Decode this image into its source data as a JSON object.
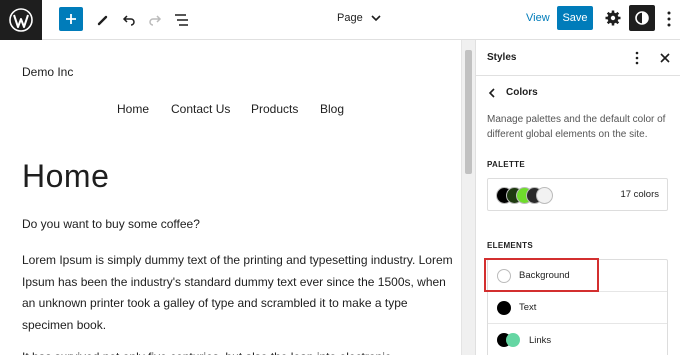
{
  "toolbar": {
    "document_title": "Page",
    "view_label": "View",
    "save_label": "Save"
  },
  "canvas": {
    "site_title": "Demo Inc",
    "nav_items": [
      "Home",
      "Contact Us",
      "Products",
      "Blog"
    ],
    "page_heading": "Home",
    "paragraphs": [
      "Do you want to buy some coffee?",
      "Lorem Ipsum is simply dummy text of the printing and typesetting industry. Lorem Ipsum has been the industry's standard dummy text ever since the 1500s, when an unknown printer took a galley of type and scrambled it to make a type specimen book.",
      "It has survived not only five centuries, but also the leap into electronic"
    ]
  },
  "sidebar": {
    "title": "Styles",
    "subpanel_title": "Colors",
    "description": "Manage palettes and the default color of different global elements on the site.",
    "palette_label": "PALETTE",
    "palette_count": "17 colors",
    "palette_swatches": [
      "#000000",
      "#1e3a10",
      "#6fdc2c",
      "#2a2a2a",
      "#f2f2f2"
    ],
    "elements_label": "ELEMENTS",
    "elements": [
      {
        "label": "Background",
        "color": "#ffffff"
      },
      {
        "label": "Text",
        "color": "#000000"
      },
      {
        "label": "Links",
        "color": "#000000",
        "color2": "#65d6a3"
      }
    ]
  },
  "colors": {
    "accent": "#007cba",
    "highlight": "#d32f2f"
  }
}
